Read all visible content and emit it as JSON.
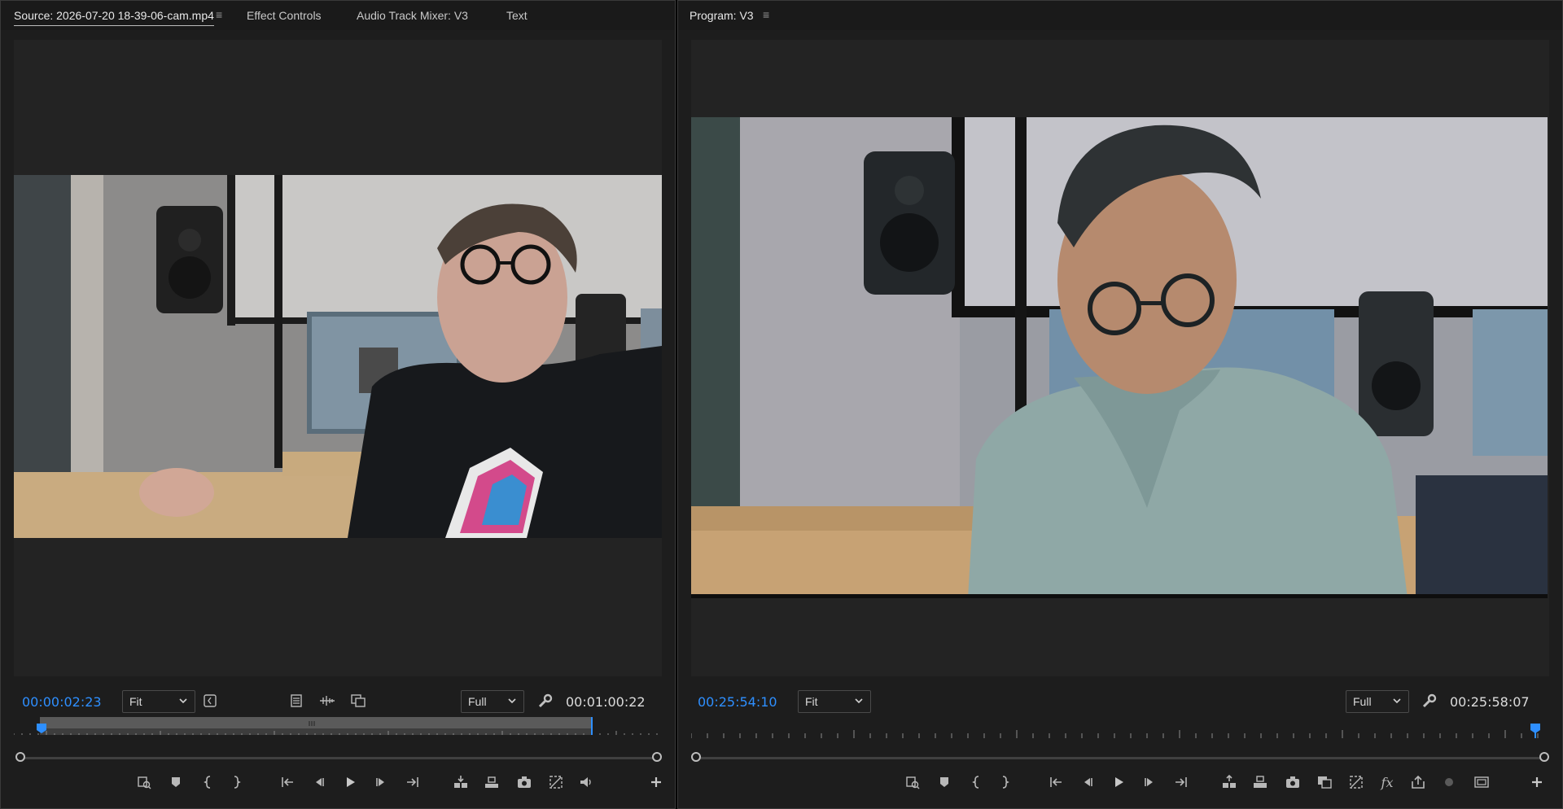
{
  "source": {
    "tabs": [
      {
        "label": "Source: 2026-07-20 18-39-06-cam.mp4"
      },
      {
        "label": "Effect Controls"
      },
      {
        "label": "Audio Track Mixer: V3"
      },
      {
        "label": "Text"
      }
    ],
    "timecode_current": "00:00:02:23",
    "zoom": "Fit",
    "resolution": "Full",
    "timecode_duration": "00:01:00:22"
  },
  "program": {
    "tab_label": "Program: V3",
    "timecode_current": "00:25:54:10",
    "zoom": "Fit",
    "resolution": "Full",
    "timecode_duration": "00:25:58:07"
  },
  "colors": {
    "accent": "#2e8fff",
    "panel_bg": "#1d1d1d"
  },
  "icons": {
    "source_controls": [
      "add-marker-icon",
      "mark-in-icon",
      "mark-out-icon",
      "go-to-in-icon",
      "step-back-icon",
      "play-icon",
      "step-forward-icon",
      "go-to-out-icon",
      "insert-icon",
      "overwrite-icon",
      "export-frame-icon",
      "settings-icon",
      "audio-icon",
      "add-button-icon"
    ],
    "program_controls": [
      "add-marker-icon",
      "mark-in-icon",
      "mark-out-icon",
      "go-to-in-icon",
      "step-back-icon",
      "play-icon",
      "step-forward-icon",
      "go-to-out-icon",
      "lift-icon",
      "extract-icon",
      "export-frame-icon",
      "comparison-view-icon",
      "proxy-icon",
      "fx-icon",
      "share-icon",
      "record-icon",
      "safe-margins-icon",
      "add-button-icon"
    ]
  }
}
